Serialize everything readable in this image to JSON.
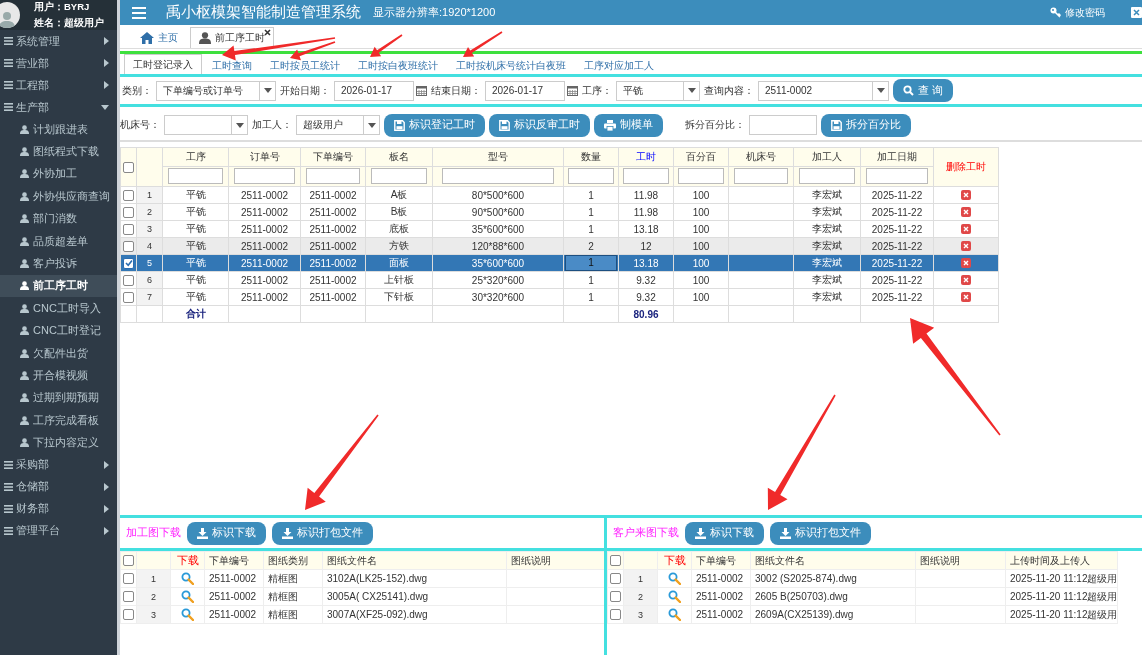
{
  "sidebar": {
    "user": "用户：BYRJ",
    "name": "姓名：超级用户",
    "menu": [
      {
        "label": "系统管理",
        "expanded": false
      },
      {
        "label": "营业部",
        "expanded": false
      },
      {
        "label": "工程部",
        "expanded": false
      },
      {
        "label": "生产部",
        "expanded": true,
        "children": [
          {
            "label": "计划跟进表",
            "selected": false
          },
          {
            "label": "图纸程式下载",
            "selected": false
          },
          {
            "label": "外协加工",
            "selected": false
          },
          {
            "label": "外协供应商查询",
            "selected": false
          },
          {
            "label": "部门消数",
            "selected": false
          },
          {
            "label": "品质超差单",
            "selected": false
          },
          {
            "label": "客户投诉",
            "selected": false
          },
          {
            "label": "前工序工时",
            "selected": true
          },
          {
            "label": "CNC工时导入",
            "selected": false
          },
          {
            "label": "CNC工时登记",
            "selected": false
          },
          {
            "label": "欠配件出货",
            "selected": false
          },
          {
            "label": "开合模视频",
            "selected": false
          },
          {
            "label": "过期到期预期",
            "selected": false
          },
          {
            "label": "工序完成看板",
            "selected": false
          },
          {
            "label": "下拉内容定义",
            "selected": false
          }
        ]
      },
      {
        "label": "采购部",
        "expanded": false
      },
      {
        "label": "仓储部",
        "expanded": false
      },
      {
        "label": "财务部",
        "expanded": false
      },
      {
        "label": "管理平台",
        "expanded": false
      }
    ]
  },
  "header": {
    "title": "禹小枢模架智能制造管理系统",
    "resolution": "显示器分辨率:1920*1200",
    "action": "修改密码"
  },
  "tabs": [
    {
      "label": "主页",
      "selected": false,
      "closable": false
    },
    {
      "label": "前工序工时",
      "selected": true,
      "closable": true
    }
  ],
  "subtabs": [
    {
      "label": "工时登记录入",
      "selected": true
    },
    {
      "label": "工时查询",
      "selected": false
    },
    {
      "label": "工时按员工统计",
      "selected": false
    },
    {
      "label": "工时按白夜班统计",
      "selected": false
    },
    {
      "label": "工时按机床号统计白夜班",
      "selected": false
    },
    {
      "label": "工序对应加工人",
      "selected": false
    }
  ],
  "filter_bar": [
    {
      "kind": "select",
      "label": "类别：",
      "value": "下单编号或订单号"
    },
    {
      "kind": "date",
      "label": "开始日期：",
      "value": "2026-01-17"
    },
    {
      "kind": "date",
      "label": "结束日期：",
      "value": "2026-01-17"
    },
    {
      "kind": "select",
      "label": "工序：",
      "value": "平铣"
    },
    {
      "kind": "select",
      "label": "查询内容：",
      "value": "2511-0002"
    },
    {
      "kind": "search",
      "label": "查 询"
    }
  ],
  "toolbar": [
    {
      "kind": "select",
      "label": "机床号："
    },
    {
      "kind": "select",
      "label": "加工人：",
      "value": "超级用户"
    },
    {
      "kind": "save",
      "label": "标识登记工时"
    },
    {
      "kind": "save",
      "label": "标识反审工时"
    },
    {
      "kind": "print",
      "label": "制模单"
    },
    {
      "kind": "input",
      "label": "拆分百分比："
    },
    {
      "kind": "save",
      "label": "拆分百分比"
    }
  ],
  "table": {
    "all_checked": false,
    "columns": [
      {
        "label": "工序",
        "kind": "process"
      },
      {
        "label": "订单号",
        "kind": "order_no"
      },
      {
        "label": "下单编号",
        "kind": "batch_no"
      },
      {
        "label": "板名",
        "kind": "board"
      },
      {
        "label": "型号",
        "kind": "model"
      },
      {
        "label": "数量",
        "kind": "qty"
      },
      {
        "label": "工时",
        "kind": "hours"
      },
      {
        "label": "百分百",
        "kind": "percent"
      },
      {
        "label": "机床号",
        "kind": "machine"
      },
      {
        "label": "加工人",
        "kind": "worker"
      },
      {
        "label": "加工日期",
        "kind": "date"
      },
      {
        "label": "删除工时",
        "kind": "delete"
      }
    ],
    "rows": [
      {
        "index": "1",
        "checked": false,
        "selected": false,
        "hovered": false,
        "editing": false,
        "process": "平铣",
        "order_no": "2511-0002",
        "batch_no": "2511-0002",
        "board": "A板",
        "model": "80*500*600",
        "qty": "1",
        "hours": "11.98",
        "percent": "100",
        "worker": "李宏斌",
        "date": "2025-11-22"
      },
      {
        "index": "2",
        "checked": false,
        "selected": false,
        "hovered": false,
        "editing": false,
        "process": "平铣",
        "order_no": "2511-0002",
        "batch_no": "2511-0002",
        "board": "B板",
        "model": "90*500*600",
        "qty": "1",
        "hours": "11.98",
        "percent": "100",
        "worker": "李宏斌",
        "date": "2025-11-22"
      },
      {
        "index": "3",
        "checked": false,
        "selected": false,
        "hovered": false,
        "editing": false,
        "process": "平铣",
        "order_no": "2511-0002",
        "batch_no": "2511-0002",
        "board": "底板",
        "model": "35*600*600",
        "qty": "1",
        "hours": "13.18",
        "percent": "100",
        "worker": "李宏斌",
        "date": "2025-11-22"
      },
      {
        "index": "4",
        "checked": false,
        "selected": false,
        "hovered": true,
        "editing": false,
        "process": "平铣",
        "order_no": "2511-0002",
        "batch_no": "2511-0002",
        "board": "方铁",
        "model": "120*88*600",
        "qty": "2",
        "hours": "12",
        "percent": "100",
        "worker": "李宏斌",
        "date": "2025-11-22"
      },
      {
        "index": "5",
        "checked": true,
        "selected": true,
        "hovered": false,
        "editing": true,
        "process": "平铣",
        "order_no": "2511-0002",
        "batch_no": "2511-0002",
        "board": "面板",
        "model": "35*600*600",
        "qty": "1",
        "hours": "13.18",
        "percent": "100",
        "worker": "李宏斌",
        "date": "2025-11-22"
      },
      {
        "index": "6",
        "checked": false,
        "selected": false,
        "hovered": false,
        "editing": false,
        "process": "平铣",
        "order_no": "2511-0002",
        "batch_no": "2511-0002",
        "board": "上针板",
        "model": "25*320*600",
        "qty": "1",
        "hours": "9.32",
        "percent": "100",
        "worker": "李宏斌",
        "date": "2025-11-22"
      },
      {
        "index": "7",
        "checked": false,
        "selected": false,
        "hovered": false,
        "editing": false,
        "process": "平铣",
        "order_no": "2511-0002",
        "batch_no": "2511-0002",
        "board": "下针板",
        "model": "30*320*600",
        "qty": "1",
        "hours": "9.32",
        "percent": "100",
        "worker": "李宏斌",
        "date": "2025-11-22"
      }
    ],
    "total": {
      "process": "合计",
      "hours": "80.96"
    }
  },
  "panels": [
    {
      "title": "加工图下载",
      "buttons": [
        "标识下载",
        "标识打包文件"
      ],
      "all_checked": false,
      "columns": [
        {
          "label": "下载",
          "kind": "download"
        },
        {
          "label": "下单编号",
          "kind": "no"
        },
        {
          "label": "图纸类别",
          "kind": "category"
        },
        {
          "label": "图纸文件名",
          "kind": "file"
        },
        {
          "label": "图纸说明",
          "kind": "note"
        }
      ],
      "rows": [
        {
          "index": "1",
          "checked": false,
          "no": "2511-0002",
          "category": "精框图",
          "file": "3102A(LK25-152).dwg"
        },
        {
          "index": "2",
          "checked": false,
          "no": "2511-0002",
          "category": "精框图",
          "file": "3005A( CX25141).dwg"
        },
        {
          "index": "3",
          "checked": false,
          "no": "2511-0002",
          "category": "精框图",
          "file": "3007A(XF25-092).dwg"
        }
      ]
    },
    {
      "title": "客户来图下载",
      "buttons": [
        "标识下载",
        "标识打包文件"
      ],
      "all_checked": false,
      "columns": [
        {
          "label": "下载",
          "kind": "download"
        },
        {
          "label": "下单编号",
          "kind": "no"
        },
        {
          "label": "图纸文件名",
          "kind": "file2"
        },
        {
          "label": "图纸说明",
          "kind": "note2"
        },
        {
          "label": "上传时间及上传人",
          "kind": "uploaded"
        }
      ],
      "rows": [
        {
          "index": "1",
          "checked": false,
          "no": "2511-0002",
          "file2": "3002 (S2025-874).dwg",
          "uploaded": "2025-11-20 11:12超级用"
        },
        {
          "index": "2",
          "checked": false,
          "no": "2511-0002",
          "file2": "2605 B(250703).dwg",
          "uploaded": "2025-11-20 11:12超级用"
        },
        {
          "index": "3",
          "checked": false,
          "no": "2511-0002",
          "file2": "2609A(CX25139).dwg",
          "uploaded": "2025-11-20 11:12超级用"
        }
      ]
    }
  ]
}
